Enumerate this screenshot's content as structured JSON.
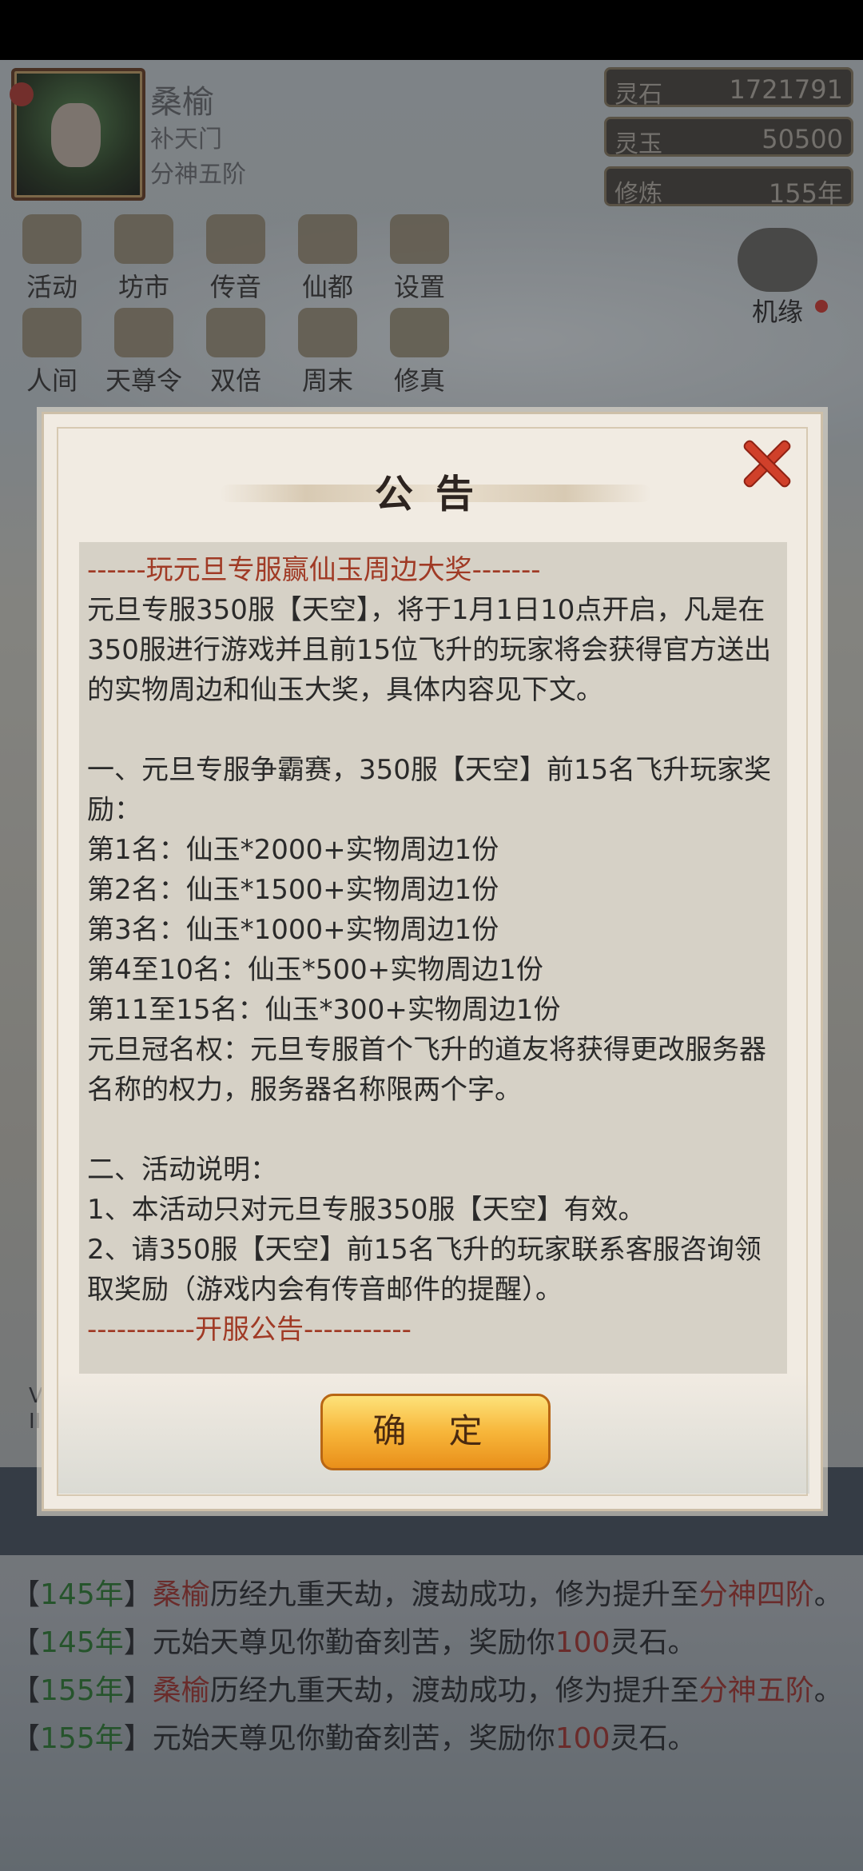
{
  "player": {
    "name": "桑榆",
    "sect": "补天门",
    "rank": "分神五阶"
  },
  "resources": [
    {
      "label": "灵石",
      "value": "1721791"
    },
    {
      "label": "灵玉",
      "value": "50500"
    },
    {
      "label": "修炼",
      "value": "155年"
    }
  ],
  "menu_row1": [
    {
      "label": "活动",
      "icon": "coin-icon"
    },
    {
      "label": "坊市",
      "icon": "shop-icon"
    },
    {
      "label": "传音",
      "icon": "mail-icon"
    },
    {
      "label": "仙都",
      "icon": "palace-icon"
    },
    {
      "label": "设置",
      "icon": "gear-icon"
    }
  ],
  "menu_row2": [
    {
      "label": "人间",
      "icon": "world-icon"
    },
    {
      "label": "天尊令",
      "icon": "token-icon"
    },
    {
      "label": "双倍",
      "icon": "double-icon"
    },
    {
      "label": "周末",
      "icon": "weekend-icon"
    },
    {
      "label": "修真",
      "icon": "cultivate-icon"
    }
  ],
  "jiyuan": {
    "label": "机缘",
    "icon": "cloud-icon"
  },
  "side_left": "V\nII",
  "modal": {
    "title": "公告",
    "header": "------玩元旦专服赢仙玉周边大奖-------",
    "body": "元旦专服350服【天空】，将于1月1日10点开启，凡是在350服进行游戏并且前15位飞升的玩家将会获得官方送出的实物周边和仙玉大奖，具体内容见下文。\n\n一、元旦专服争霸赛，350服【天空】前15名飞升玩家奖励：\n第1名：仙玉*2000+实物周边1份\n第2名：仙玉*1500+实物周边1份\n第3名：仙玉*1000+实物周边1份\n第4至10名：仙玉*500+实物周边1份\n第11至15名：仙玉*300+实物周边1份\n元旦冠名权：元旦专服首个飞升的道友将获得更改服务器名称的权力，服务器名称限两个字。\n\n二、活动说明：\n1、本活动只对元旦专服350服【天空】有效。\n2、请350服【天空】前15名飞升的玩家联系客服咨询领取奖励（游戏内会有传音邮件的提醒）。\n",
    "footer_header": "-----------开服公告-----------",
    "confirm_label": "确 定"
  },
  "log": [
    {
      "year": "145年",
      "name": "桑榆",
      "text1": "历经九重天劫，渡劫成功，修为提升至",
      "rank": "分神四阶",
      "end": "。"
    },
    {
      "year": "145年",
      "text1": "元始天尊见你勤奋刻苦，奖励你",
      "num": "100",
      "text2": "灵石。"
    },
    {
      "year": "155年",
      "name": "桑榆",
      "text1": "历经九重天劫，渡劫成功，修为提升至",
      "rank": "分神五阶",
      "end": "。"
    },
    {
      "year": "155年",
      "text1": "元始天尊见你勤奋刻苦，奖励你",
      "num": "100",
      "text2": "灵石。"
    }
  ]
}
